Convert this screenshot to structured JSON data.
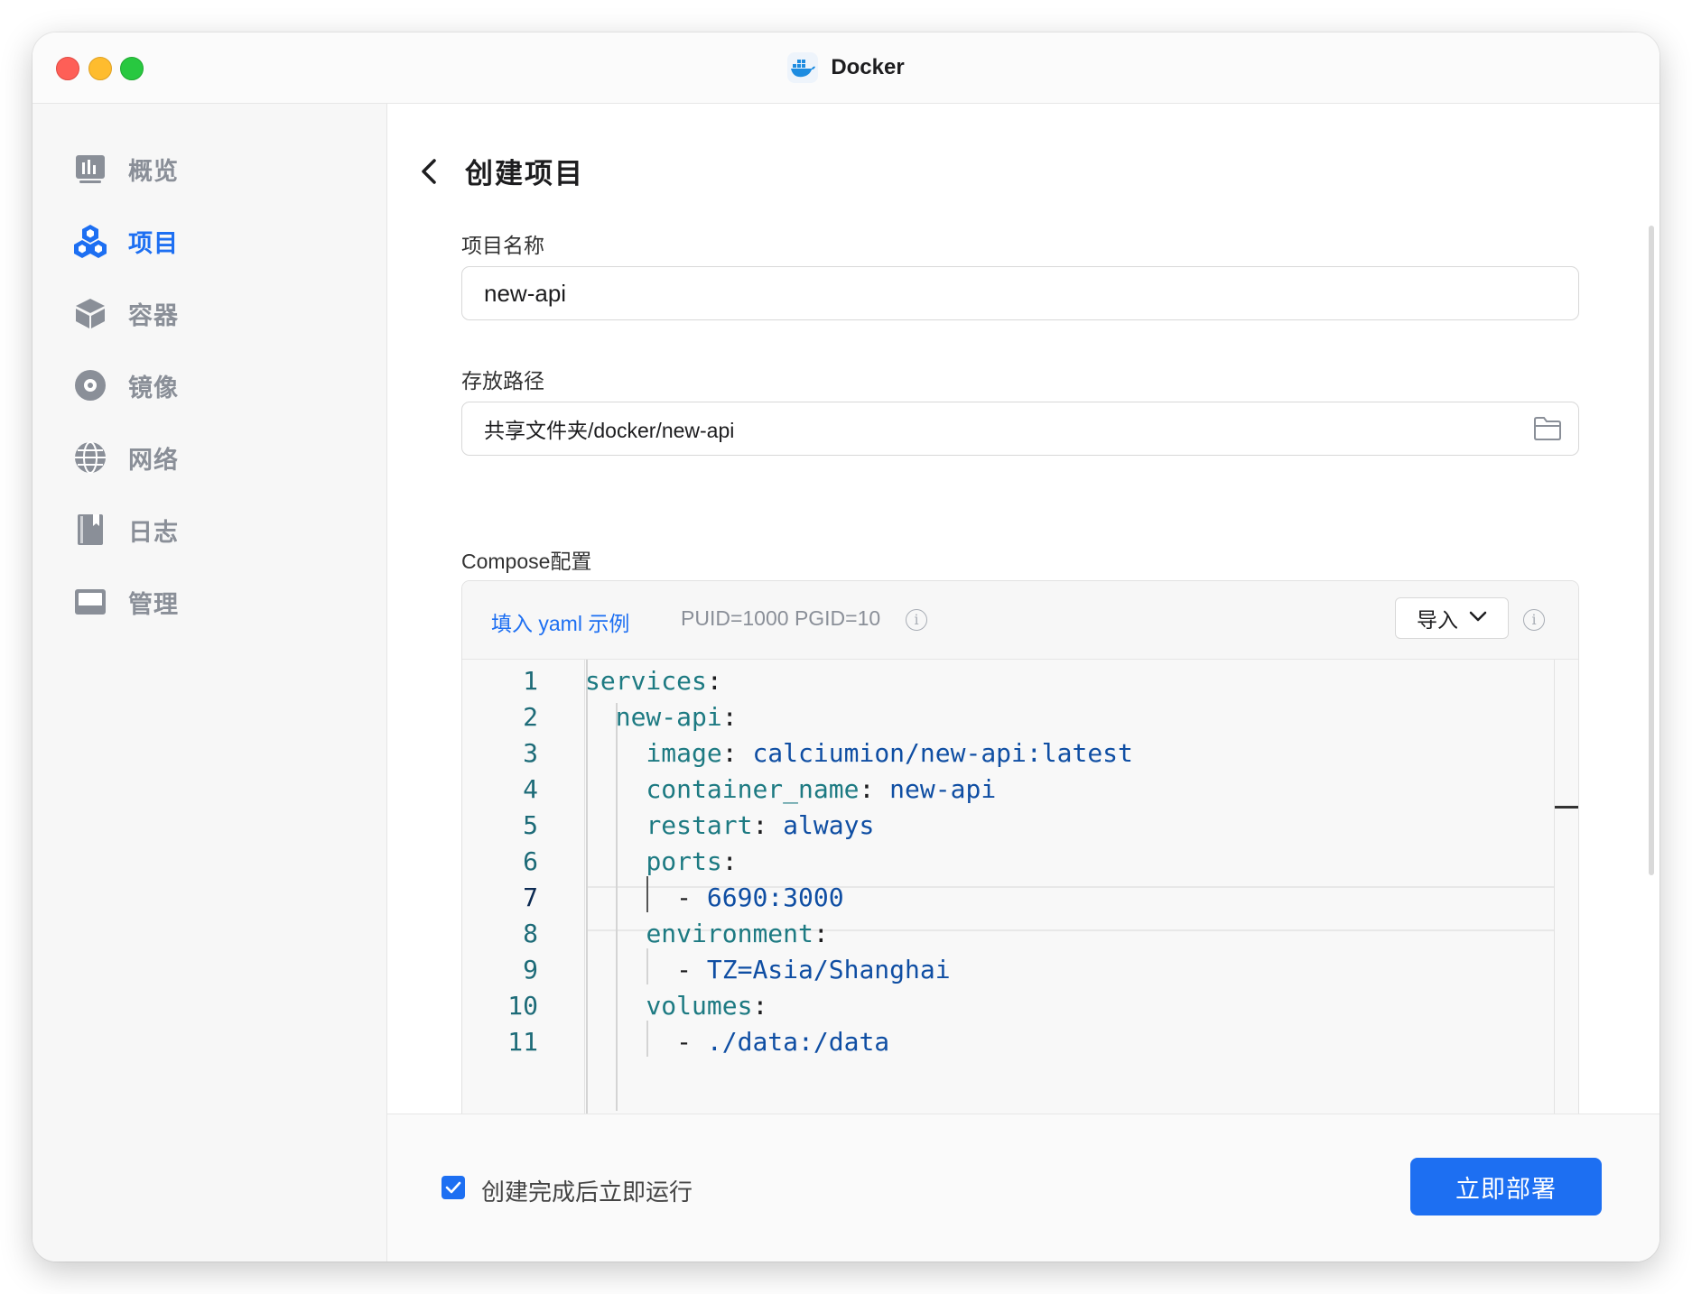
{
  "window": {
    "title": "Docker"
  },
  "sidebar": {
    "items": [
      {
        "label": "概览",
        "icon": "overview-icon",
        "active": false
      },
      {
        "label": "项目",
        "icon": "project-icon",
        "active": true
      },
      {
        "label": "容器",
        "icon": "container-icon",
        "active": false
      },
      {
        "label": "镜像",
        "icon": "image-icon",
        "active": false
      },
      {
        "label": "网络",
        "icon": "network-icon",
        "active": false
      },
      {
        "label": "日志",
        "icon": "log-icon",
        "active": false
      },
      {
        "label": "管理",
        "icon": "manage-icon",
        "active": false
      }
    ]
  },
  "page": {
    "title": "创建项目"
  },
  "form": {
    "name_label": "项目名称",
    "name_value": "new-api",
    "path_label": "存放路径",
    "path_value": "共享文件夹/docker/new-api",
    "compose_label": "Compose配置"
  },
  "editor": {
    "yaml_example": "填入 yaml 示例",
    "puid_hint": "PUID=1000 PGID=10",
    "import_label": "导入",
    "active_line": 7,
    "lines": [
      {
        "n": "1",
        "indent": "",
        "key": "services",
        "sep": ":",
        "val": ""
      },
      {
        "n": "2",
        "indent": "  ",
        "key": "new-api",
        "sep": ":",
        "val": ""
      },
      {
        "n": "3",
        "indent": "    ",
        "key": "image",
        "sep": ": ",
        "val": "calciumion/new-api:latest"
      },
      {
        "n": "4",
        "indent": "    ",
        "key": "container_name",
        "sep": ": ",
        "val": "new-api"
      },
      {
        "n": "5",
        "indent": "    ",
        "key": "restart",
        "sep": ": ",
        "val": "always"
      },
      {
        "n": "6",
        "indent": "    ",
        "key": "ports",
        "sep": ":",
        "val": ""
      },
      {
        "n": "7",
        "indent": "      ",
        "key": "",
        "sep": "- ",
        "val": "6690:3000"
      },
      {
        "n": "8",
        "indent": "    ",
        "key": "environment",
        "sep": ":",
        "val": ""
      },
      {
        "n": "9",
        "indent": "      ",
        "key": "",
        "sep": "- ",
        "val": "TZ=Asia/Shanghai"
      },
      {
        "n": "10",
        "indent": "    ",
        "key": "volumes",
        "sep": ":",
        "val": ""
      },
      {
        "n": "11",
        "indent": "      ",
        "key": "",
        "sep": "- ",
        "val": "./data:/data"
      }
    ]
  },
  "footer": {
    "run_after_label": "创建完成后立即运行",
    "run_after_checked": true,
    "deploy_label": "立即部署"
  },
  "colors": {
    "accent": "#1d6ff2",
    "key": "#1d7a82",
    "value": "#0f4ea3"
  }
}
